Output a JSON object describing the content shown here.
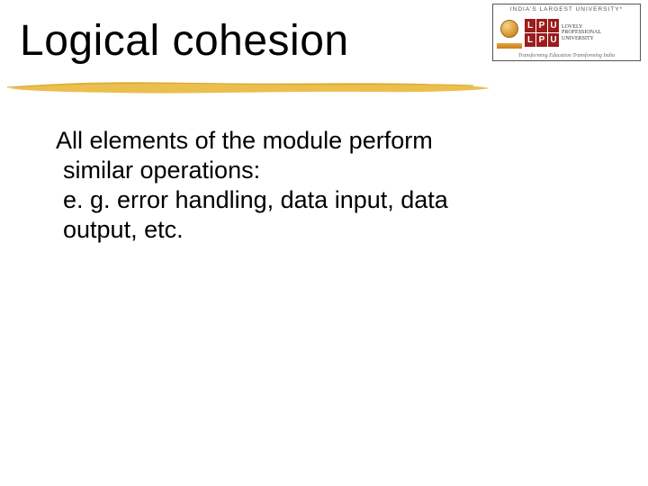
{
  "title": "Logical cohesion",
  "body": {
    "line1": "All elements of the module perform",
    "line2": "similar operations:",
    "line3": "e. g. error handling, data input, data",
    "line4": "output, etc."
  },
  "logo": {
    "top_text": "INDIA'S LARGEST UNIVERSITY*",
    "letters": [
      "L",
      "P",
      "U"
    ],
    "name_line1": "LOVELY",
    "name_line2": "PROFESSIONAL",
    "name_line3": "UNIVERSITY",
    "tagline": "Transforming Education Transforming India"
  },
  "colors": {
    "underline": "#e8b83a"
  }
}
